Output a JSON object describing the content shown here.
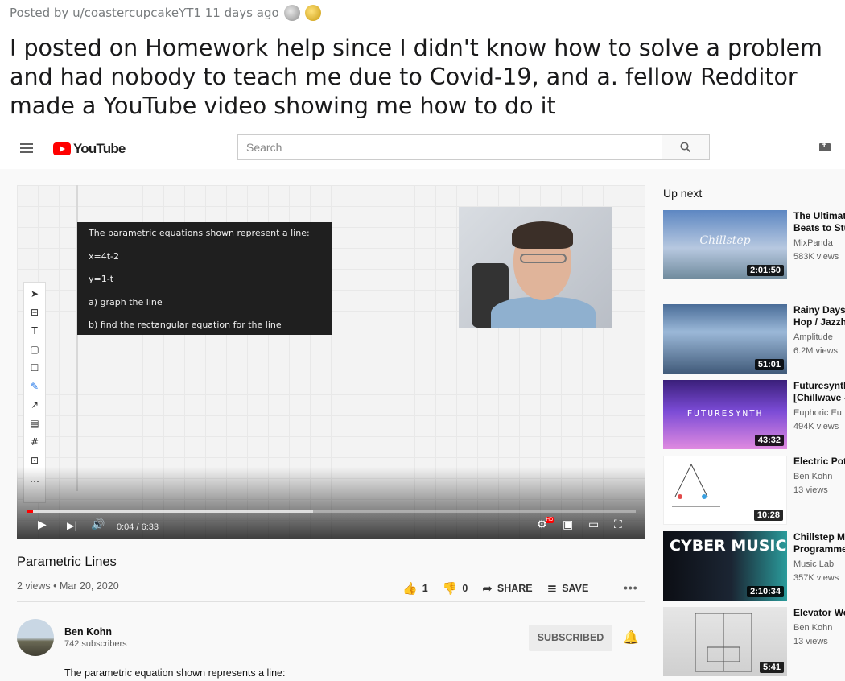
{
  "reddit": {
    "meta": "Posted by u/coastercupcakeYT1 11 days ago",
    "title": "I posted on Homework help since I didn't know how to solve a problem and had nobody to teach me due to Covid-19, and a. fellow Redditor made a YouTube video showing me how to do it"
  },
  "youtube": {
    "logo_text": "YouTube",
    "search_placeholder": "Search",
    "player": {
      "equations": [
        "The parametric equations shown represent a line:",
        "x=4t-2",
        "y=1-t",
        "a) graph the line",
        "b) find the rectangular equation for the line"
      ],
      "time": "0:04 / 6:33",
      "progress_fraction": 0.01,
      "buffer_fraction": 0.47,
      "hd_badge": "HD"
    },
    "video": {
      "title": "Parametric Lines",
      "meta": "2 views • Mar 20, 2020",
      "likes": "1",
      "dislikes": "0",
      "share": "SHARE",
      "save": "SAVE"
    },
    "channel": {
      "name": "Ben Kohn",
      "subscribers": "742 subscribers",
      "subscribe_label": "SUBSCRIBED"
    },
    "description": "The parametric equation shown represents a line:",
    "up_next_label": "Up next",
    "recommendations": [
      {
        "title1": "The Ultimat",
        "title2": "Beats to Stu",
        "channel": "MixPanda",
        "views": "583K views",
        "duration": "2:01:50",
        "thumb_text": "Chillstep"
      },
      {
        "title1": "Rainy Days",
        "title2": "Hop / Jazzh",
        "channel": "Amplitude",
        "views": "6.2M views",
        "duration": "51:01",
        "thumb_text": ""
      },
      {
        "title1": "Futuresynth",
        "title2": "[Chillwave -",
        "channel": "Euphoric Eu",
        "views": "494K views",
        "duration": "43:32",
        "thumb_text": "FUTURESYNTH"
      },
      {
        "title1": "Electric Pot",
        "title2": "",
        "channel": "Ben Kohn",
        "views": "13 views",
        "duration": "10:28",
        "thumb_text": ""
      },
      {
        "title1": "Chillstep M",
        "title2": "Programme",
        "channel": "Music Lab",
        "views": "357K views",
        "duration": "2:10:34",
        "thumb_text": "CYBER MUSIC"
      },
      {
        "title1": "Elevator We",
        "title2": "",
        "channel": "Ben Kohn",
        "views": "13 views",
        "duration": "5:41",
        "thumb_text": ""
      }
    ]
  }
}
